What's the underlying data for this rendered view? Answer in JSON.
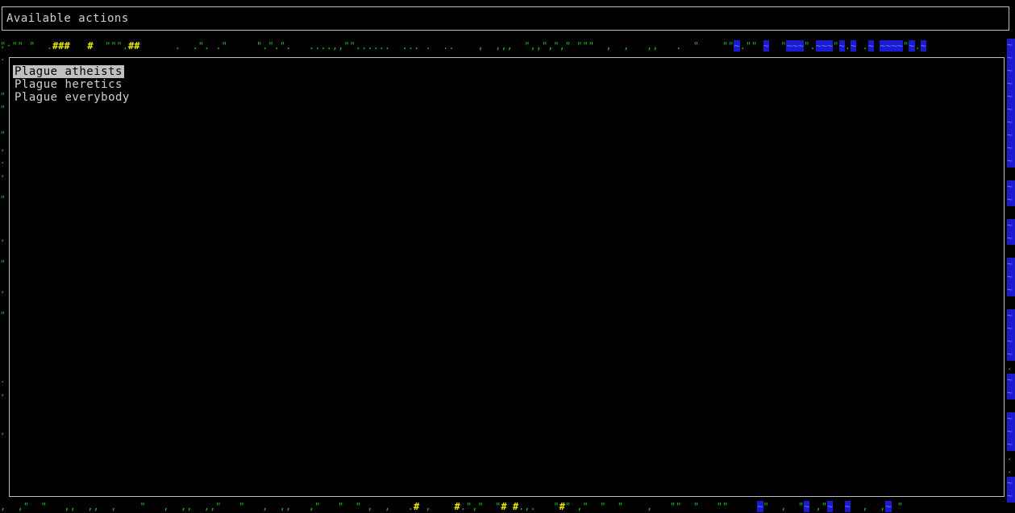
{
  "header": {
    "title": "Available actions"
  },
  "menu": {
    "items": [
      {
        "label": "Plague atheists",
        "selected": true
      },
      {
        "label": "Plague heretics",
        "selected": false
      },
      {
        "label": "Plague everybody",
        "selected": false
      }
    ]
  },
  "colors": {
    "background": "#000000",
    "text": "#d0d0d0",
    "selection": "#c0c0c0",
    "grass": "#1fb51f",
    "wall": "#e8e800",
    "water": "#1a1ad0"
  }
}
